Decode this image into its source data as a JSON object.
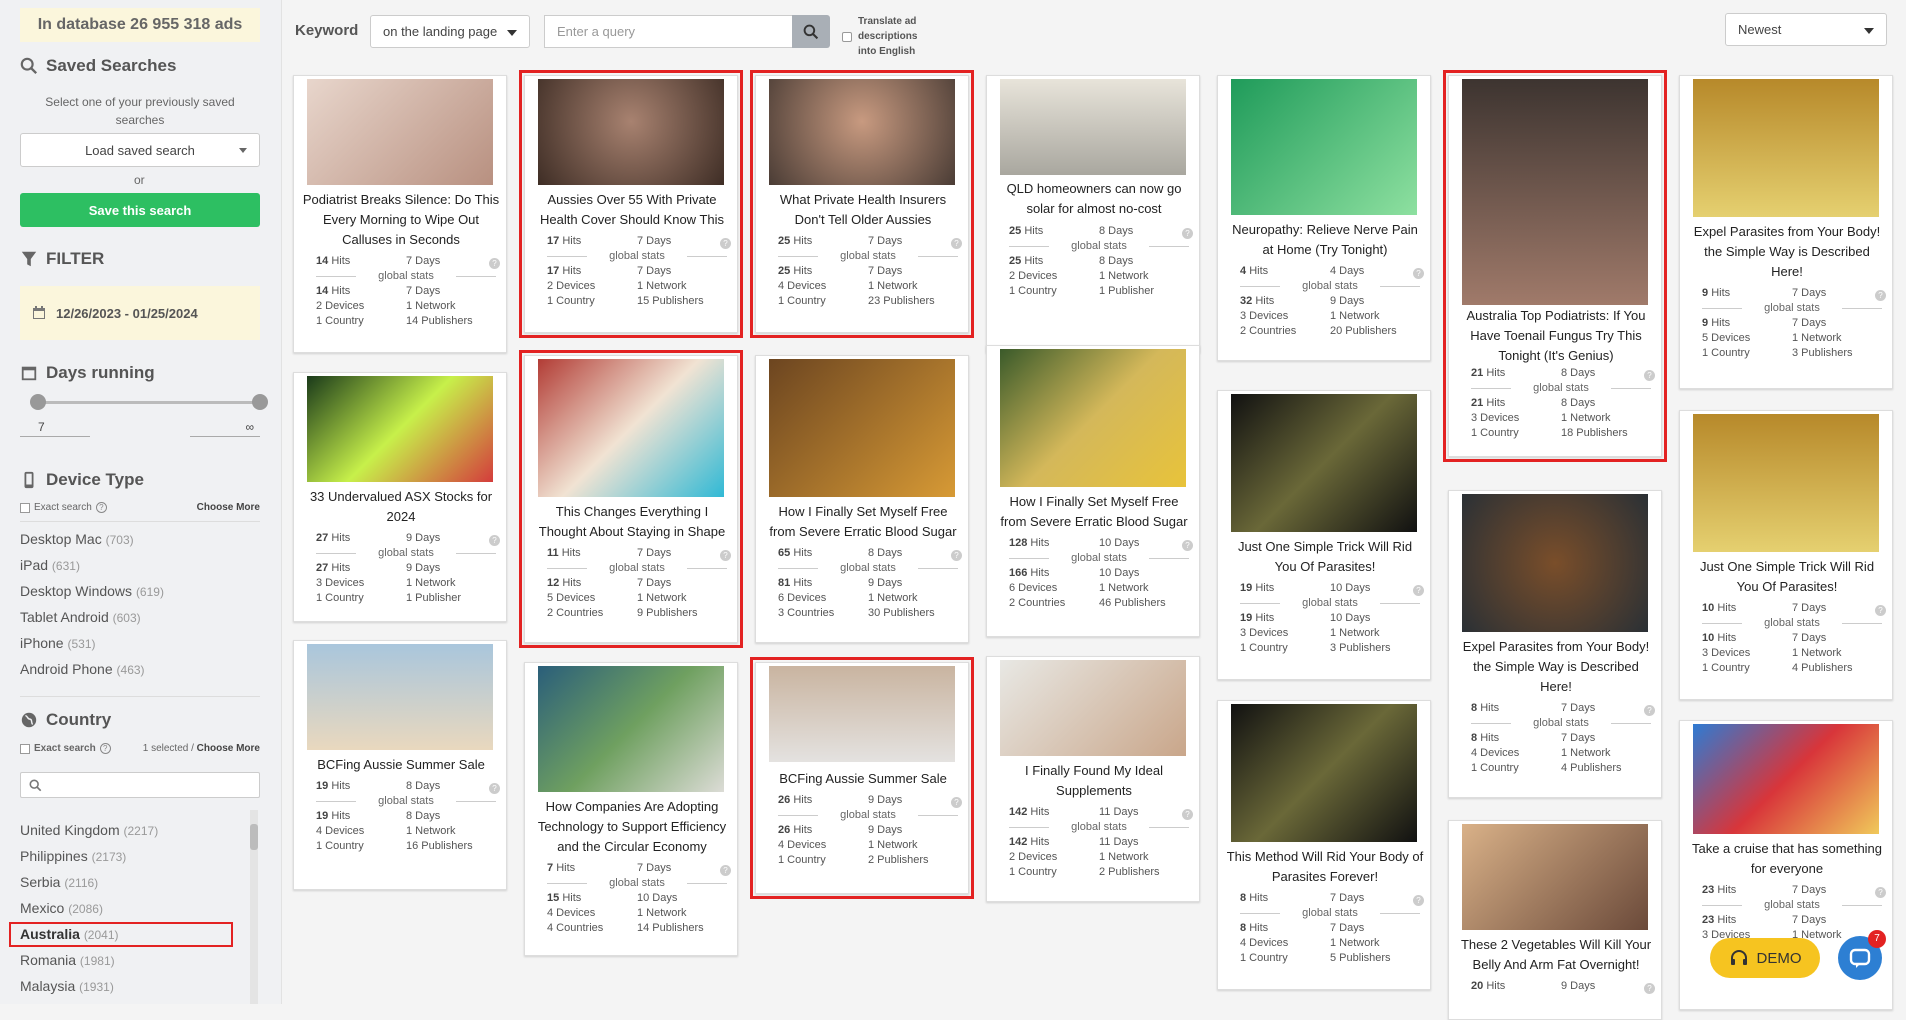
{
  "sidebar": {
    "db_count": "In database 26 955 318 ads",
    "saved_title": "Saved Searches",
    "saved_hint": "Select one of your previously saved searches",
    "load_label": "Load saved search",
    "or_label": "or",
    "save_label": "Save this search",
    "filter_title": "FILTER",
    "date_range": "12/26/2023 - 01/25/2024",
    "days_title": "Days running",
    "days_min": "7",
    "days_max": "∞",
    "device_title": "Device Type",
    "exact_search": "Exact search",
    "choose_more": "Choose More",
    "devices": [
      {
        "name": "Desktop Mac",
        "count": "(703)"
      },
      {
        "name": "iPad",
        "count": "(631)"
      },
      {
        "name": "Desktop Windows",
        "count": "(619)"
      },
      {
        "name": "Tablet Android",
        "count": "(603)"
      },
      {
        "name": "iPhone",
        "count": "(531)"
      },
      {
        "name": "Android Phone",
        "count": "(463)"
      }
    ],
    "country_title": "Country",
    "country_selected": "1 selected / ",
    "countries": [
      {
        "name": "United Kingdom",
        "count": "(2217)"
      },
      {
        "name": "Philippines",
        "count": "(2173)"
      },
      {
        "name": "Serbia",
        "count": "(2116)"
      },
      {
        "name": "Mexico",
        "count": "(2086)"
      },
      {
        "name": "Australia",
        "count": "(2041)"
      },
      {
        "name": "Romania",
        "count": "(1981)"
      },
      {
        "name": "Malaysia",
        "count": "(1931)"
      }
    ]
  },
  "topbar": {
    "keyword_label": "Keyword",
    "scope": "on the landing page",
    "query_placeholder": "Enter a query",
    "translate": "Translate ad descriptions into English",
    "sort": "Newest"
  },
  "labels": {
    "hits": "Hits",
    "global": "global stats"
  },
  "cards": [
    {
      "title": "Podiatrist Breaks Silence: Do This Every Morning to Wipe Out Calluses in Seconds",
      "hits": "14",
      "days": "7 Days",
      "g_hits": "14",
      "g_days": "7 Days",
      "devices": "2 Devices",
      "network": "1 Network",
      "countries": "1 Country",
      "publishers": "14 Publishers"
    },
    {
      "title": "Aussies Over 55 With Private Health Cover Should Know This",
      "hits": "17",
      "days": "7 Days",
      "g_hits": "17",
      "g_days": "7 Days",
      "devices": "2 Devices",
      "network": "1 Network",
      "countries": "1 Country",
      "publishers": "15 Publishers"
    },
    {
      "title": "What Private Health Insurers Don't Tell Older Aussies",
      "hits": "25",
      "days": "7 Days",
      "g_hits": "25",
      "g_days": "7 Days",
      "devices": "4 Devices",
      "network": "1 Network",
      "countries": "1 Country",
      "publishers": "23 Publishers"
    },
    {
      "title": "QLD homeowners can now go solar for almost no-cost",
      "hits": "25",
      "days": "8 Days",
      "g_hits": "25",
      "g_days": "8 Days",
      "devices": "2 Devices",
      "network": "1 Network",
      "countries": "1 Country",
      "publishers": "1 Publisher"
    },
    {
      "title": "Neuropathy: Relieve Nerve Pain at Home (Try Tonight)",
      "hits": "4",
      "days": "4 Days",
      "g_hits": "32",
      "g_days": "9 Days",
      "devices": "3 Devices",
      "network": "1 Network",
      "countries": "2 Countries",
      "publishers": "20 Publishers"
    },
    {
      "title": "Australia Top Podiatrists: If You Have Toenail Fungus Try This Tonight (It's Genius)",
      "hits": "21",
      "days": "8 Days",
      "g_hits": "21",
      "g_days": "8 Days",
      "devices": "3 Devices",
      "network": "1 Network",
      "countries": "1 Country",
      "publishers": "18 Publishers"
    },
    {
      "title": "Expel Parasites from Your Body! the Simple Way is Described Here!",
      "hits": "9",
      "days": "7 Days",
      "g_hits": "9",
      "g_days": "7 Days",
      "devices": "5 Devices",
      "network": "1 Network",
      "countries": "1 Country",
      "publishers": "3 Publishers"
    },
    {
      "title": "33 Undervalued ASX Stocks for 2024",
      "hits": "27",
      "days": "9 Days",
      "g_hits": "27",
      "g_days": "9 Days",
      "devices": "3 Devices",
      "network": "1 Network",
      "countries": "1 Country",
      "publishers": "1 Publisher"
    },
    {
      "title": "This Changes Everything I Thought About Staying in Shape",
      "hits": "11",
      "days": "7 Days",
      "g_hits": "12",
      "g_days": "7 Days",
      "devices": "5 Devices",
      "network": "1 Network",
      "countries": "2 Countries",
      "publishers": "9 Publishers"
    },
    {
      "title": "How I Finally Set Myself Free from Severe Erratic Blood Sugar",
      "hits": "65",
      "days": "8 Days",
      "g_hits": "81",
      "g_days": "9 Days",
      "devices": "6 Devices",
      "network": "1 Network",
      "countries": "3 Countries",
      "publishers": "30 Publishers"
    },
    {
      "title": "How I Finally Set Myself Free from Severe Erratic Blood Sugar",
      "hits": "128",
      "days": "10 Days",
      "g_hits": "166",
      "g_days": "10 Days",
      "devices": "6 Devices",
      "network": "1 Network",
      "countries": "2 Countries",
      "publishers": "46 Publishers"
    },
    {
      "title": "Just One Simple Trick Will Rid You Of Parasites!",
      "hits": "19",
      "days": "10 Days",
      "g_hits": "19",
      "g_days": "10 Days",
      "devices": "3 Devices",
      "network": "1 Network",
      "countries": "1 Country",
      "publishers": "3 Publishers"
    },
    {
      "title": "Expel Parasites from Your Body! the Simple Way is Described Here!",
      "hits": "8",
      "days": "7 Days",
      "g_hits": "8",
      "g_days": "7 Days",
      "devices": "4 Devices",
      "network": "1 Network",
      "countries": "1 Country",
      "publishers": "4 Publishers"
    },
    {
      "title": "Just One Simple Trick Will Rid You Of Parasites!",
      "hits": "10",
      "days": "7 Days",
      "g_hits": "10",
      "g_days": "7 Days",
      "devices": "3 Devices",
      "network": "1 Network",
      "countries": "1 Country",
      "publishers": "4 Publishers"
    },
    {
      "title": "BCFing Aussie Summer Sale",
      "hits": "19",
      "days": "8 Days",
      "g_hits": "19",
      "g_days": "8 Days",
      "devices": "4 Devices",
      "network": "1 Network",
      "countries": "1 Country",
      "publishers": "16 Publishers"
    },
    {
      "title": "How Companies Are Adopting Technology to Support Efficiency and the Circular Economy",
      "hits": "7",
      "days": "7 Days",
      "g_hits": "15",
      "g_days": "10 Days",
      "devices": "4 Devices",
      "network": "1 Network",
      "countries": "4 Countries",
      "publishers": "14 Publishers"
    },
    {
      "title": "BCFing Aussie Summer Sale",
      "hits": "26",
      "days": "9 Days",
      "g_hits": "26",
      "g_days": "9 Days",
      "devices": "4 Devices",
      "network": "1 Network",
      "countries": "1 Country",
      "publishers": "2 Publishers"
    },
    {
      "title": "I Finally Found My Ideal Supplements",
      "hits": "142",
      "days": "11 Days",
      "g_hits": "142",
      "g_days": "11 Days",
      "devices": "2 Devices",
      "network": "1 Network",
      "countries": "1 Country",
      "publishers": "2 Publishers"
    },
    {
      "title": "This Method Will Rid Your Body of Parasites Forever!",
      "hits": "8",
      "days": "7 Days",
      "g_hits": "8",
      "g_days": "7 Days",
      "devices": "4 Devices",
      "network": "1 Network",
      "countries": "1 Country",
      "publishers": "5 Publishers"
    },
    {
      "title": "Take a cruise that has something for everyone",
      "hits": "23",
      "days": "7 Days",
      "g_hits": "23",
      "g_days": "7 Days",
      "devices": "3 Devices",
      "network": "1 Network",
      "countries": "",
      "publishers": ""
    },
    {
      "title": "These 2 Vegetables Will Kill Your Belly And Arm Fat Overnight!",
      "hits": "20",
      "days": "9 Days"
    }
  ],
  "widgets": {
    "demo": "DEMO",
    "chat_badge": "7"
  },
  "colors": {
    "accent_green": "#2dbf62",
    "highlight_red": "#e32222",
    "db_bg": "#fbf6dc",
    "demo_yellow": "#f6c420",
    "chat_blue": "#2d7fd3"
  }
}
